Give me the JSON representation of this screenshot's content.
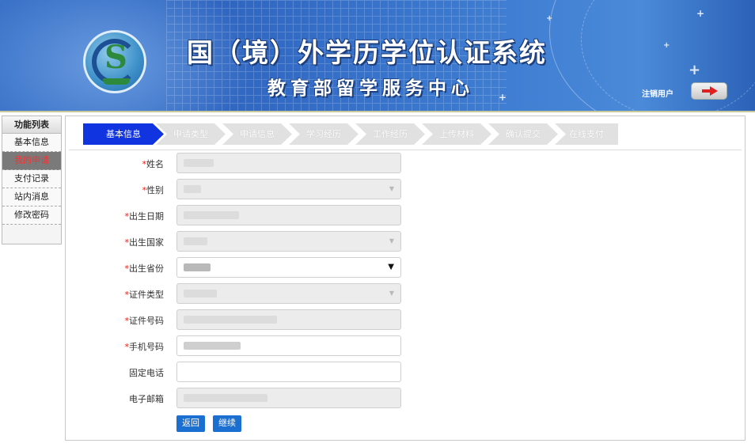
{
  "header": {
    "title": "国（境）外学历学位认证系统",
    "subtitle": "教育部留学服务中心",
    "logout_label": "注销用户",
    "colors": {
      "banner": "#2f66c2",
      "title_outline": "#1d3f7d"
    }
  },
  "sidebar": {
    "title": "功能列表",
    "items": [
      {
        "label": "基本信息",
        "active": false
      },
      {
        "label": "我的申请",
        "active": true
      },
      {
        "label": "支付记录",
        "active": false
      },
      {
        "label": "站内消息",
        "active": false
      },
      {
        "label": "修改密码",
        "active": false
      }
    ],
    "active_color": "#ff2f2f"
  },
  "steps": [
    {
      "label": "基本信息",
      "active": true
    },
    {
      "label": "申请类型",
      "active": false
    },
    {
      "label": "申请信息",
      "active": false
    },
    {
      "label": "学习经历",
      "active": false
    },
    {
      "label": "工作经历",
      "active": false
    },
    {
      "label": "上传材料",
      "active": false
    },
    {
      "label": "确认提交",
      "active": false
    },
    {
      "label": "在线支付",
      "active": false
    }
  ],
  "form": {
    "fields": [
      {
        "label": "姓名",
        "required": true,
        "type": "text",
        "readonly": true
      },
      {
        "label": "性别",
        "required": true,
        "type": "select",
        "readonly": true
      },
      {
        "label": "出生日期",
        "required": true,
        "type": "text",
        "readonly": true
      },
      {
        "label": "出生国家",
        "required": true,
        "type": "select",
        "readonly": true
      },
      {
        "label": "出生省份",
        "required": true,
        "type": "select",
        "readonly": false
      },
      {
        "label": "证件类型",
        "required": true,
        "type": "select",
        "readonly": true
      },
      {
        "label": "证件号码",
        "required": true,
        "type": "text",
        "readonly": true
      },
      {
        "label": "手机号码",
        "required": true,
        "type": "text",
        "readonly": false
      },
      {
        "label": "固定电话",
        "required": false,
        "type": "text",
        "readonly": false
      },
      {
        "label": "电子邮箱",
        "required": false,
        "type": "text",
        "readonly": true
      }
    ],
    "required_mark": "*",
    "back_label": "返回",
    "continue_label": "继续"
  },
  "icons": {
    "logout": "arrow-right-icon",
    "dropdown": "triangle-down-icon",
    "logo": "emblem-logo"
  },
  "accent_colors": {
    "step_active": "#1034e0",
    "button": "#1a6fd0",
    "required": "#e2231a"
  }
}
